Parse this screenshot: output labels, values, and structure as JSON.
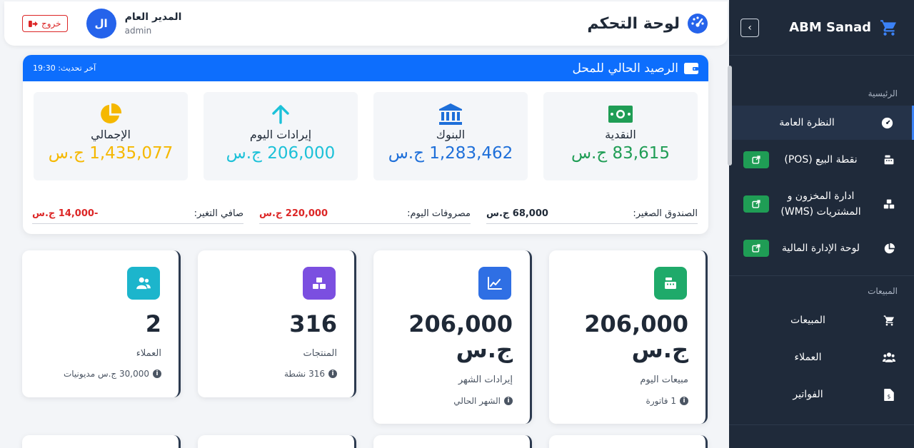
{
  "header": {
    "title": "لوحة التحكم",
    "user_name": "المدير العام",
    "user_role": "admin",
    "avatar_initials": "ال",
    "logout_label": "خروج"
  },
  "sidebar": {
    "brand": "ABM Sanad",
    "sections": [
      {
        "title": "الرئيسية"
      },
      {
        "title": "المبيعات"
      }
    ],
    "main_items": [
      {
        "label": "النظرة العامة",
        "icon": "gauge-icon",
        "active": true
      },
      {
        "label": "نقطة البيع (POS)",
        "icon": "cash-register-icon",
        "external": true
      },
      {
        "label": "ادارة المخزون و المشتريات (WMS)",
        "icon": "boxes-icon",
        "external": true
      },
      {
        "label": "لوحة الإدارة المالية",
        "icon": "pie-chart-icon",
        "external": true
      }
    ],
    "sales_items": [
      {
        "label": "المبيعات",
        "icon": "cart-icon"
      },
      {
        "label": "العملاء",
        "icon": "users-icon"
      },
      {
        "label": "الفواتير",
        "icon": "invoice-icon"
      }
    ]
  },
  "balance": {
    "title": "الرصيد الحالي للمحل",
    "last_update_label": "آخر تحديث: 19:30",
    "tiles": [
      {
        "label": "النقدية",
        "value": "83,615 ج.س",
        "color": "#1f9d55",
        "icon": "money-icon"
      },
      {
        "label": "البنوك",
        "value": "1,283,462 ج.س",
        "color": "#1e6fd9",
        "icon": "bank-icon"
      },
      {
        "label": "إيرادات اليوم",
        "value": "206,000 ج.س",
        "color": "#1cc1d8",
        "icon": "arrow-up-icon"
      },
      {
        "label": "الإجمالي",
        "value": "1,435,077 ج.س",
        "color": "#f5b800",
        "icon": "pie-chart-icon"
      }
    ],
    "summary": [
      {
        "label": "الصندوق الصغير:",
        "value": "68,000 ج.س",
        "color": "#1f2937"
      },
      {
        "label": "مصروفات اليوم:",
        "value": "220,000 ج.س",
        "color": "#dc2626"
      },
      {
        "label": "صافي التغير:",
        "value": "-14,000 ج.س",
        "color": "#dc2626"
      }
    ]
  },
  "cards": [
    {
      "value": "206,000 ج.س",
      "label": "مبيعات اليوم",
      "footer": "1 فاتورة",
      "color": "#1faa6a",
      "icon": "cash-register-icon"
    },
    {
      "value": "206,000 ج.س",
      "label": "إيرادات الشهر",
      "footer": "الشهر الحالي",
      "color": "#2f6fe4",
      "icon": "line-chart-icon"
    },
    {
      "value": "316",
      "label": "المنتجات",
      "footer": "316 نشطة",
      "color": "#7b4fe0",
      "icon": "boxes-icon"
    },
    {
      "value": "2",
      "label": "العملاء",
      "footer": "30,000 ج.س مديونيات",
      "color": "#1cb5cc",
      "icon": "users-icon"
    }
  ]
}
